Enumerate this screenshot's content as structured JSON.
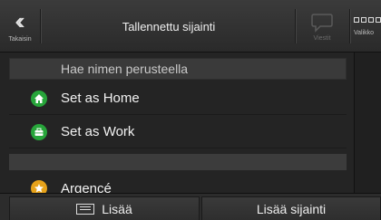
{
  "header": {
    "back_label": "Takaisin",
    "title": "Tallennettu sijainti",
    "messages_label": "Viestit",
    "menu_label": "Valikko"
  },
  "search": {
    "placeholder": "Hae nimen perusteella"
  },
  "items": [
    {
      "label": "Set as Home",
      "icon": "home-icon",
      "color": "#27a53a"
    },
    {
      "label": "Set as Work",
      "icon": "briefcase-icon",
      "color": "#27a53a"
    },
    {
      "label": "Argencé",
      "icon": "star-icon",
      "color": "#e6a21a"
    }
  ],
  "footer": {
    "add_label": "Lisää",
    "add_location_label": "Lisää sijainti"
  }
}
